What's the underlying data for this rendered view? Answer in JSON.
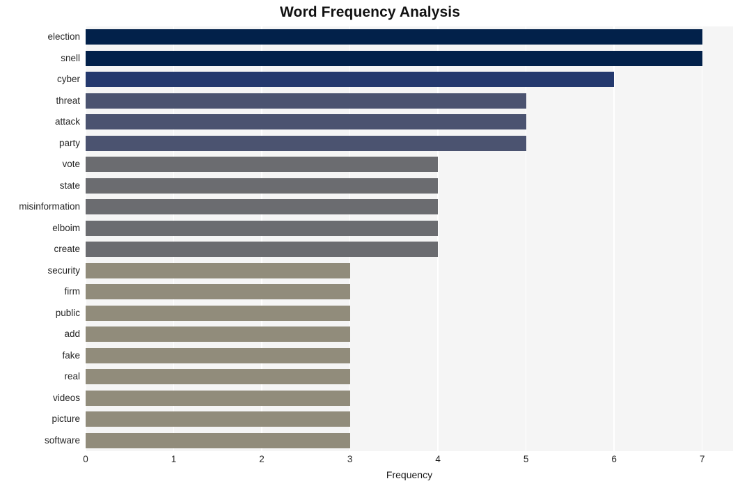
{
  "chart_data": {
    "type": "bar",
    "orientation": "horizontal",
    "title": "Word Frequency Analysis",
    "xlabel": "Frequency",
    "ylabel": "",
    "xlim": [
      0,
      7.35
    ],
    "ylim": [
      0,
      20
    ],
    "xticks": [
      0,
      1,
      2,
      3,
      4,
      5,
      6,
      7
    ],
    "xtick_labels": [
      "0",
      "1",
      "2",
      "3",
      "4",
      "5",
      "6",
      "7"
    ],
    "grid": "vertical-white-on-gray",
    "legend": null,
    "categories": [
      "election",
      "snell",
      "cyber",
      "threat",
      "attack",
      "party",
      "vote",
      "state",
      "misinformation",
      "elboim",
      "create",
      "security",
      "firm",
      "public",
      "add",
      "fake",
      "real",
      "videos",
      "picture",
      "software"
    ],
    "values": [
      7,
      7,
      6,
      5,
      5,
      5,
      4,
      4,
      4,
      4,
      4,
      3,
      3,
      3,
      3,
      3,
      3,
      3,
      3,
      3
    ],
    "bar_colors": [
      "#02214a",
      "#02214a",
      "#24396e",
      "#4b5370",
      "#4b5370",
      "#4b5370",
      "#6b6c70",
      "#6b6c70",
      "#6b6c70",
      "#6b6c70",
      "#6b6c70",
      "#918c7b",
      "#918c7b",
      "#918c7b",
      "#918c7b",
      "#918c7b",
      "#918c7b",
      "#918c7b",
      "#918c7b",
      "#918c7b"
    ],
    "bars": [
      {
        "label": "election",
        "value": 7,
        "color": "#02214a"
      },
      {
        "label": "snell",
        "value": 7,
        "color": "#02214a"
      },
      {
        "label": "cyber",
        "value": 6,
        "color": "#24396e"
      },
      {
        "label": "threat",
        "value": 5,
        "color": "#4b5370"
      },
      {
        "label": "attack",
        "value": 5,
        "color": "#4b5370"
      },
      {
        "label": "party",
        "value": 5,
        "color": "#4b5370"
      },
      {
        "label": "vote",
        "value": 4,
        "color": "#6b6c70"
      },
      {
        "label": "state",
        "value": 4,
        "color": "#6b6c70"
      },
      {
        "label": "misinformation",
        "value": 4,
        "color": "#6b6c70"
      },
      {
        "label": "elboim",
        "value": 4,
        "color": "#6b6c70"
      },
      {
        "label": "create",
        "value": 4,
        "color": "#6b6c70"
      },
      {
        "label": "security",
        "value": 3,
        "color": "#918c7b"
      },
      {
        "label": "firm",
        "value": 3,
        "color": "#918c7b"
      },
      {
        "label": "public",
        "value": 3,
        "color": "#918c7b"
      },
      {
        "label": "add",
        "value": 3,
        "color": "#918c7b"
      },
      {
        "label": "fake",
        "value": 3,
        "color": "#918c7b"
      },
      {
        "label": "real",
        "value": 3,
        "color": "#918c7b"
      },
      {
        "label": "videos",
        "value": 3,
        "color": "#918c7b"
      },
      {
        "label": "picture",
        "value": 3,
        "color": "#918c7b"
      },
      {
        "label": "software",
        "value": 3,
        "color": "#918c7b"
      }
    ],
    "plot_background": "#f5f5f5",
    "figure_background": "#ffffff"
  }
}
